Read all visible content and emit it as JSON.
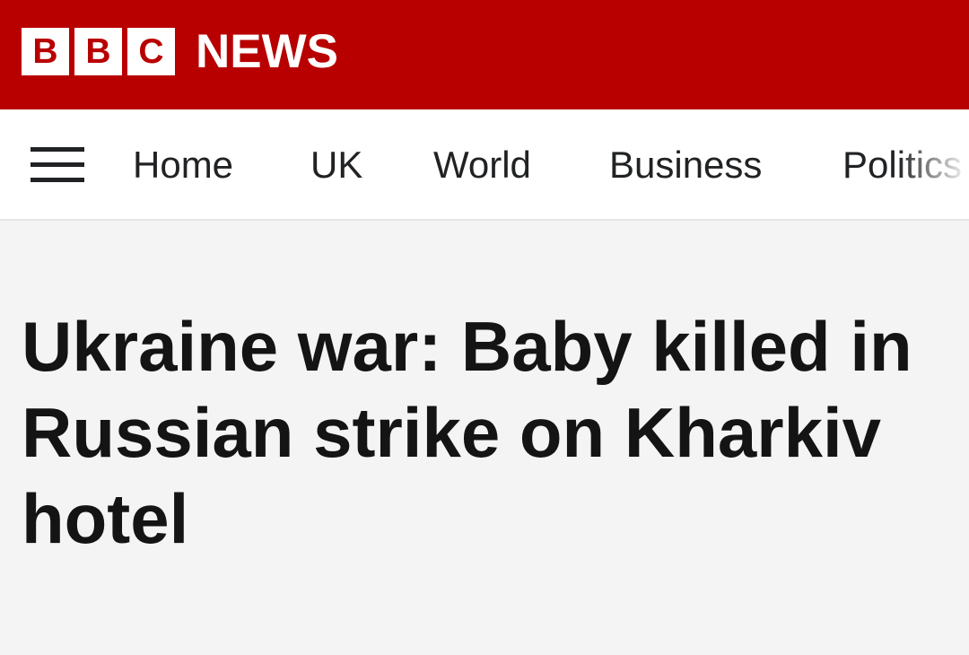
{
  "header": {
    "logo_letters": [
      "B",
      "B",
      "C"
    ],
    "logo_word": "NEWS",
    "brand_color": "#b80000"
  },
  "nav": {
    "menu_icon": "hamburger-menu-icon",
    "items": [
      {
        "label": "Home"
      },
      {
        "label": "UK"
      },
      {
        "label": "World"
      },
      {
        "label": "Business"
      },
      {
        "label": "Politics"
      }
    ]
  },
  "article": {
    "headline": "Ukraine war: Baby killed in Russian strike on Kharkiv hotel"
  }
}
